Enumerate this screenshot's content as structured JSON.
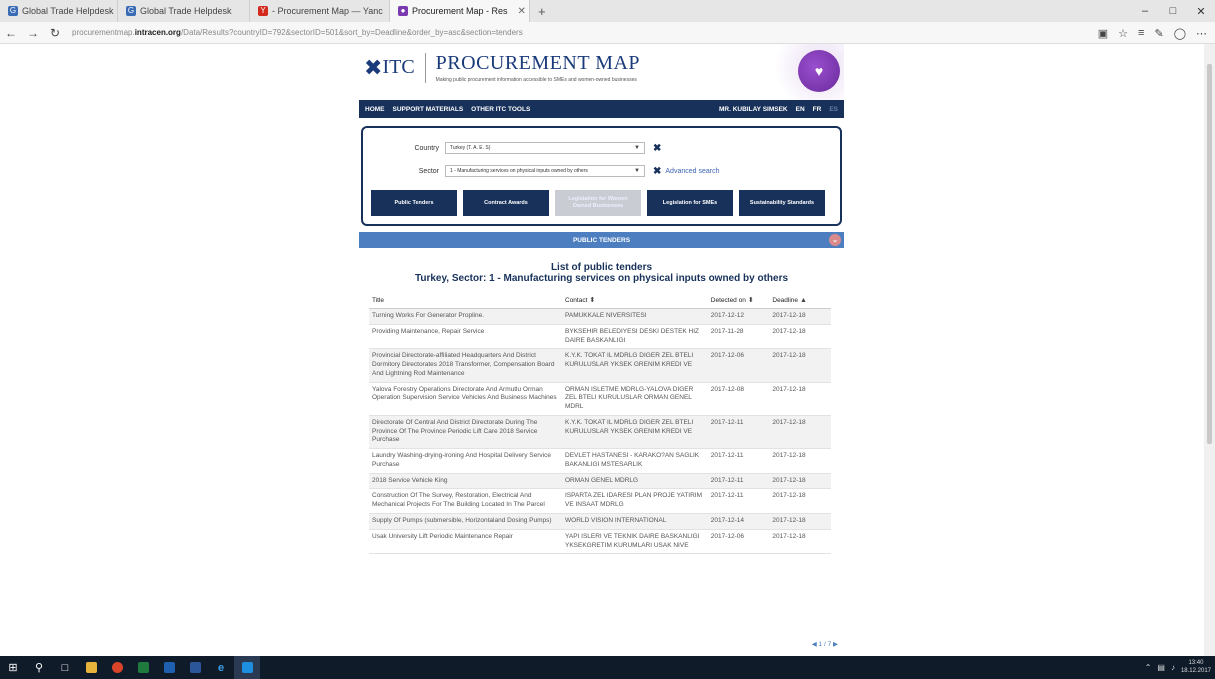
{
  "browser": {
    "tabs": [
      {
        "label": "Global Trade Helpdesk",
        "icon_color": "#3a6bb5",
        "active": false
      },
      {
        "label": "Global Trade Helpdesk",
        "icon_color": "#3a6bb5",
        "active": false
      },
      {
        "label": "- Procurement Map — Yanc",
        "icon_color": "#d4281c",
        "active": false
      },
      {
        "label": "Procurement Map - Res",
        "icon_color": "#7a3ab0",
        "active": true
      }
    ],
    "new_tab": "+",
    "url_prefix": "procurementmap.",
    "url_host": "intracen.org",
    "url_path": "/Data/Results?countryID=792&sectorID=501&sort_by=Deadline&order_by=asc&section=tenders"
  },
  "site": {
    "itc_label": "ITC",
    "title": "PROCUREMENT MAP",
    "subtitle": "Making public procurement information accessible to SMEs and women-owned businesses",
    "nav": {
      "home": "HOME",
      "support": "SUPPORT MATERIALS",
      "other_tools": "OTHER ITC TOOLS",
      "user": "MR. KUBILAY SIMSEK",
      "lang_en": "EN",
      "lang_fr": "FR",
      "lang_es": "ES"
    },
    "filter": {
      "country_label": "Country",
      "country_value": "Turkey (T. A. E. S)",
      "sector_label": "Sector",
      "sector_value": "1 - Manufacturing services on physical inputs owned by others",
      "advanced_search": "Advanced search"
    },
    "buttons": {
      "public_tenders": "Public Tenders",
      "contract_awards": "Contract Awards",
      "legislation_women": "Legislation for Women Owned Businesses",
      "legislation_smes": "Legislation for SMEs",
      "sustainability": "Sustainability Standards"
    },
    "section_title": "PUBLIC TENDERS",
    "list_title": "List of public tenders",
    "list_subtitle": "Turkey, Sector: 1 - Manufacturing services on physical inputs owned by others",
    "table": {
      "headers": {
        "title": "Title",
        "contact": "Contact",
        "detected": "Detected on",
        "deadline": "Deadline"
      },
      "rows": [
        {
          "title": "Turning Works For Generator Propline.",
          "contact": "PAMUKKALE NIVERSITESI",
          "detected": "2017-12-12",
          "deadline": "2017-12-18"
        },
        {
          "title": "Providing Maintenance, Repair Service",
          "contact": "BYKSEHIR BELEDIYESI DESKI DESTEK HIZ DAIRE BASKANLIGI",
          "detected": "2017-11-28",
          "deadline": "2017-12-18"
        },
        {
          "title": "Provincial Directorate-affiliated Headquarters And District Dormitory Directorates 2018 Transformer, Compensation Board And Lightning Rod Maintenance",
          "contact": "K.Y.K. TOKAT IL MDRLG DIGER ZEL BTELI KURULUSLAR YKSEK GRENIM KREDI VE",
          "detected": "2017-12-06",
          "deadline": "2017-12-18"
        },
        {
          "title": "Yalova Forestry Operations Directorate And Armutlu Orman Operation Supervision Service Vehicles And Business Machines",
          "contact": "ORMAN ISLETME MDRLG-YALOVA DIGER ZEL BTELI KURULUSLAR ORMAN GENEL MDRL",
          "detected": "2017-12-08",
          "deadline": "2017-12-18"
        },
        {
          "title": "Directorate Of Central And District Directorate During The Province Of The Province Periodic Lift Care 2018 Service Purchase",
          "contact": "K.Y.K. TOKAT IL MDRLG DIGER ZEL BTELI KURULUSLAR YKSEK GRENIM KREDI VE",
          "detected": "2017-12-11",
          "deadline": "2017-12-18"
        },
        {
          "title": "Laundry Washing-drying-ironing And Hospital Delivery Service Purchase",
          "contact": "DEVLET HASTANESI - KARAKO?AN SAGLIK BAKANLIGI MSTESARLIK",
          "detected": "2017-12-11",
          "deadline": "2017-12-18"
        },
        {
          "title": "2018 Service Vehicle King",
          "contact": "ORMAN GENEL MDRLG",
          "detected": "2017-12-11",
          "deadline": "2017-12-18"
        },
        {
          "title": "Construction Of The Survey, Restoration, Electrical And Mechanical Projects For The Building Located In The Parcel",
          "contact": "ISPARTA ZEL IDARESI PLAN PROJE YATIRIM VE INSAAT MDRLG",
          "detected": "2017-12-11",
          "deadline": "2017-12-18"
        },
        {
          "title": "Supply Of Pumps (submersible, Horizontaland Dosing Pumps)",
          "contact": "WORLD VISION INTERNATIONAL",
          "detected": "2017-12-14",
          "deadline": "2017-12-18"
        },
        {
          "title": "Usak University Lift Periodic Maintenance Repair",
          "contact": "YAPI ISLERI VE TEKNIK DAIRE BASKANLIGI YKSEKGRETIM KURUMLARI USAK NIVE",
          "detected": "2017-12-06",
          "deadline": "2017-12-18"
        }
      ]
    },
    "pager": "1 / 7"
  },
  "taskbar": {
    "clock_time": "13:40",
    "clock_date": "18.12.2017"
  },
  "colors": {
    "navy": "#17315a",
    "section_blue": "#4d7ec0"
  }
}
